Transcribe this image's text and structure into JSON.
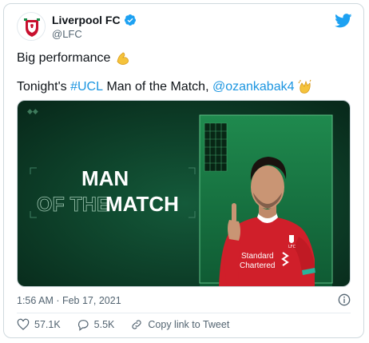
{
  "tweet": {
    "author_name": "Liverpool FC",
    "author_handle": "@LFC",
    "line1": "Big performance",
    "line1_emoji": "flexed-biceps",
    "line2_prefix": "Tonight's ",
    "hashtag": "#UCL",
    "line2_middle": " Man of the Match, ",
    "mention": "@ozankabak4",
    "line2_emoji": "clapping-hands",
    "timestamp": "1:56 AM · Feb 17, 2021"
  },
  "media": {
    "headline_line1": "MAN",
    "headline_of_the": "OF THE",
    "headline_match": "MATCH",
    "shirt_sponsor_line1": "Standard",
    "shirt_sponsor_line2": "Chartered",
    "crest_text": "LFC"
  },
  "actions": {
    "likes": "57.1K",
    "replies": "5.5K",
    "copy_link": "Copy link to Tweet"
  },
  "colors": {
    "accent": "#1b95e0",
    "verified": "#1da1f2",
    "kit_red": "#d01f2a",
    "bg_green": "#0e3a26"
  },
  "icons": [
    "twitter-bird-icon",
    "verified-badge-icon",
    "info-icon",
    "heart-icon",
    "reply-icon",
    "link-icon"
  ]
}
